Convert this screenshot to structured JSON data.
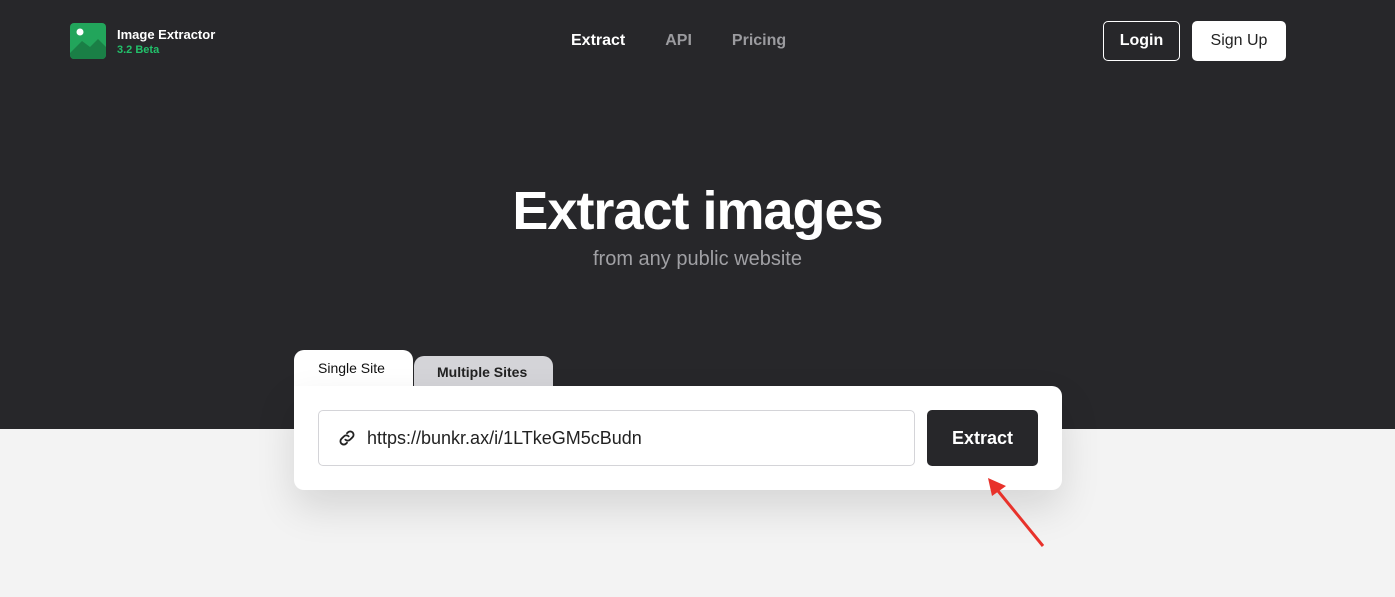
{
  "brand": {
    "name": "Image Extractor",
    "version": "3.2 Beta",
    "color": "#22a55b"
  },
  "nav": {
    "items": [
      {
        "label": "Extract",
        "active": true
      },
      {
        "label": "API"
      },
      {
        "label": "Pricing"
      }
    ]
  },
  "auth": {
    "login": "Login",
    "signup": "Sign Up"
  },
  "hero": {
    "title": "Extract images",
    "subtitle": "from any public website"
  },
  "tabs": [
    {
      "label": "Single Site",
      "active": true
    },
    {
      "label": "Multiple Sites"
    }
  ],
  "form": {
    "url_value": "https://bunkr.ax/i/1LTkeGM5cBudn",
    "submit": "Extract"
  },
  "annotation": {
    "arrow_color": "#e8322b"
  }
}
